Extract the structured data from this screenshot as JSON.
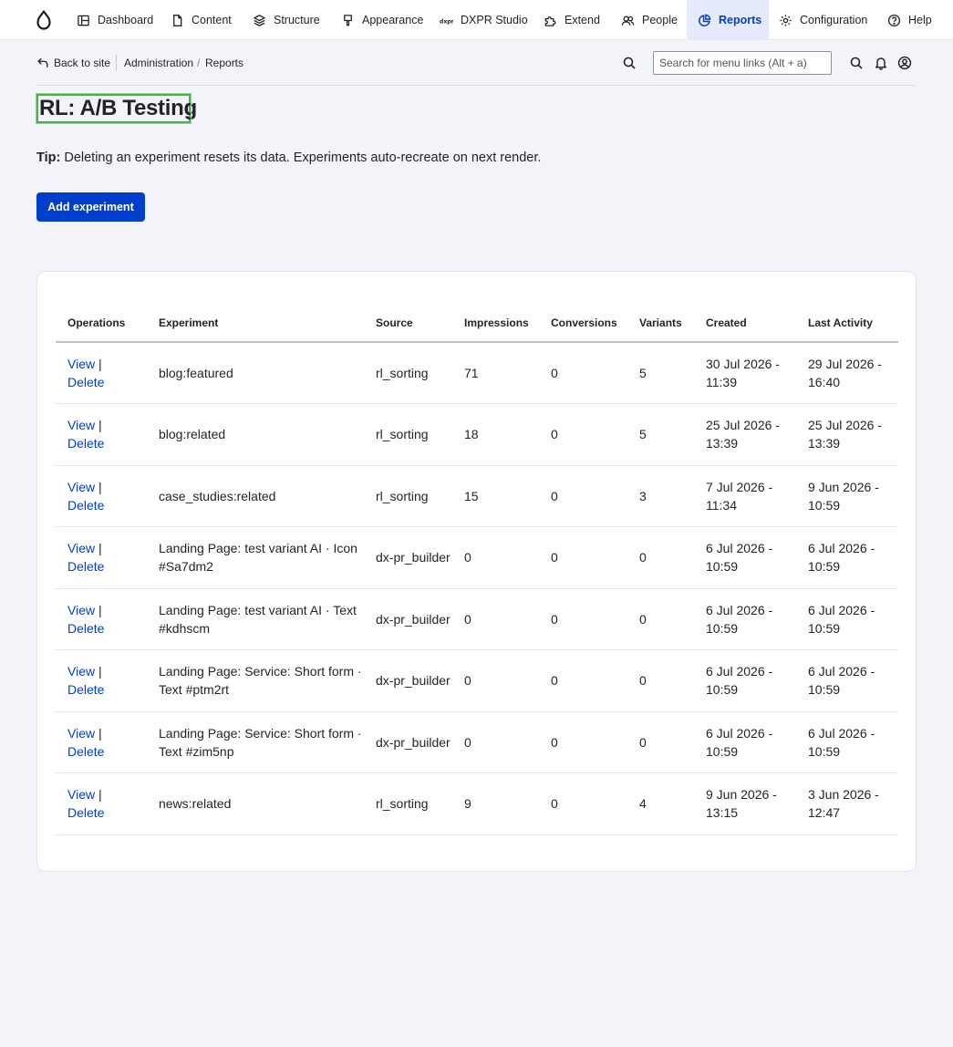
{
  "toolbar": {
    "items": [
      {
        "label": "Dashboard"
      },
      {
        "label": "Content"
      },
      {
        "label": "Structure"
      },
      {
        "label": "Appearance"
      },
      {
        "label": "DXPR Studio"
      },
      {
        "label": "Extend"
      },
      {
        "label": "People"
      },
      {
        "label": "Reports"
      },
      {
        "label": "Configuration"
      },
      {
        "label": "Help"
      }
    ],
    "active_item": "Reports",
    "accent_color": "#003ecc"
  },
  "adminbar": {
    "back_label": "Back to site",
    "breadcrumb": [
      "Administration",
      "Reports"
    ],
    "search_placeholder": "Search for menu links (Alt + a)"
  },
  "page": {
    "title": "RL: A/B Testing",
    "tip_label": "Tip:",
    "tip_text": "Deleting an experiment resets its data. Experiments auto-recreate on next render.",
    "add_button": "Add experiment"
  },
  "table": {
    "headers": [
      "Operations",
      "Experiment",
      "Source",
      "Impressions",
      "Conversions",
      "Variants",
      "Created",
      "Last Activity"
    ],
    "view_label": "View",
    "delete_label": "Delete",
    "rows": [
      {
        "experiment": "blog:featured",
        "source": "rl_sorting",
        "impressions": "71",
        "conversions": "0",
        "variants": "5",
        "created": "30 Jul 2026 - 11:39",
        "last_activity": "29 Jul 2026 - 16:40"
      },
      {
        "experiment": "blog:related",
        "source": "rl_sorting",
        "impressions": "18",
        "conversions": "0",
        "variants": "5",
        "created": "25 Jul 2026 - 13:39",
        "last_activity": "25 Jul 2026 - 13:39"
      },
      {
        "experiment": "case_studies:related",
        "source": "rl_sorting",
        "impressions": "15",
        "conversions": "0",
        "variants": "3",
        "created": "7 Jul 2026 - 11:34",
        "last_activity": "9 Jun 2026 - 10:59"
      },
      {
        "experiment": "Landing Page: test variant AI · Icon #Sa7dm2",
        "source": "dx-pr_builder",
        "impressions": "0",
        "conversions": "0",
        "variants": "0",
        "created": "6 Jul 2026 - 10:59",
        "last_activity": "6 Jul 2026 - 10:59"
      },
      {
        "experiment": "Landing Page: test variant AI · Text #kdhscm",
        "source": "dx-pr_builder",
        "impressions": "0",
        "conversions": "0",
        "variants": "0",
        "created": "6 Jul 2026 - 10:59",
        "last_activity": "6 Jul 2026 - 10:59"
      },
      {
        "experiment": "Landing Page: Service: Short form · Text #ptm2rt",
        "source": "dx-pr_builder",
        "impressions": "0",
        "conversions": "0",
        "variants": "0",
        "created": "6 Jul 2026 - 10:59",
        "last_activity": "6 Jul 2026 - 10:59"
      },
      {
        "experiment": "Landing Page: Service: Short form · Text #zim5np",
        "source": "dx-pr_builder",
        "impressions": "0",
        "conversions": "0",
        "variants": "0",
        "created": "6 Jul 2026 - 10:59",
        "last_activity": "6 Jul 2026 - 10:59"
      },
      {
        "experiment": "news:related",
        "source": "rl_sorting",
        "impressions": "9",
        "conversions": "0",
        "variants": "4",
        "created": "9 Jun 2026 - 13:15",
        "last_activity": "3 Jun 2026 - 12:47"
      }
    ]
  }
}
